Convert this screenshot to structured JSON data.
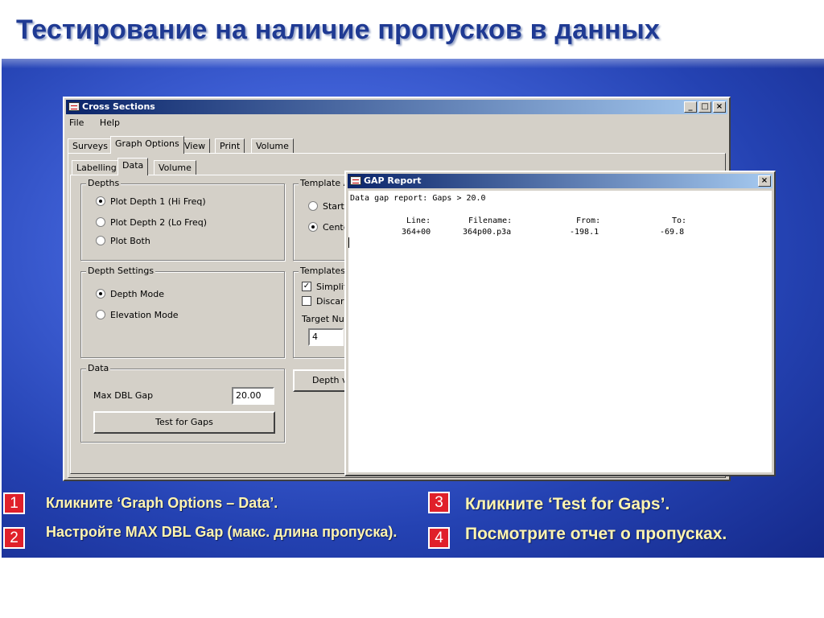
{
  "slide": {
    "title": "Тестирование на наличие пропусков в данных",
    "accent_color": "#1f3a93",
    "step_color": "#e0202a",
    "step_text_color": "#fff4b0"
  },
  "cross_sections": {
    "title": "Cross  Sections",
    "menu": [
      "File",
      "Help"
    ],
    "main_tabs": [
      "Surveys",
      "Graph Options",
      "View",
      "Print",
      "Volume"
    ],
    "active_main_tab": "Graph Options",
    "sub_tabs": [
      "Labelling",
      "Data",
      "Volume"
    ],
    "active_sub_tab": "Data",
    "depths": {
      "title": "Depths",
      "options": [
        "Plot Depth 1 (Hi Freq)",
        "Plot Depth 2 (Lo Freq)",
        "Plot Both"
      ],
      "selected": "Plot Depth 1 (Hi Freq)"
    },
    "depth_settings": {
      "title": "Depth Settings",
      "options": [
        "Depth Mode",
        "Elevation Mode"
      ],
      "selected": "Depth Mode"
    },
    "data_group": {
      "title": "Data",
      "max_gap_label": "Max DBL Gap",
      "max_gap_value": "20.00",
      "test_button": "Test for Gaps"
    },
    "template_a": {
      "title": "Template A",
      "options": [
        "Start",
        "Cente"
      ],
      "selected": "Cente"
    },
    "templates": {
      "title": "Templates",
      "checks": [
        {
          "label": "Simplify",
          "checked": true
        },
        {
          "label": "Discard",
          "checked": false
        }
      ],
      "target_label": "Target Num",
      "target_value": "4"
    },
    "depth_button": "Depth v"
  },
  "gap_report": {
    "title": "GAP Report",
    "header_line": "Data gap report: Gaps > 20.0",
    "columns": [
      "Line:",
      "Filename:",
      "From:",
      "To:"
    ],
    "rows": [
      {
        "line": "364+00",
        "filename": "364p00.p3a",
        "from": "-198.1",
        "to": "-69.8"
      }
    ]
  },
  "steps": [
    {
      "num": "1",
      "text": "Кликните ‘Graph Options – Data’."
    },
    {
      "num": "2",
      "text": "Настройте MAX DBL Gap (макс. длина пропуска)."
    },
    {
      "num": "3",
      "text": "Кликните ‘Test for Gaps’."
    },
    {
      "num": "4",
      "text": "Посмотрите отчет о пропусках."
    }
  ]
}
